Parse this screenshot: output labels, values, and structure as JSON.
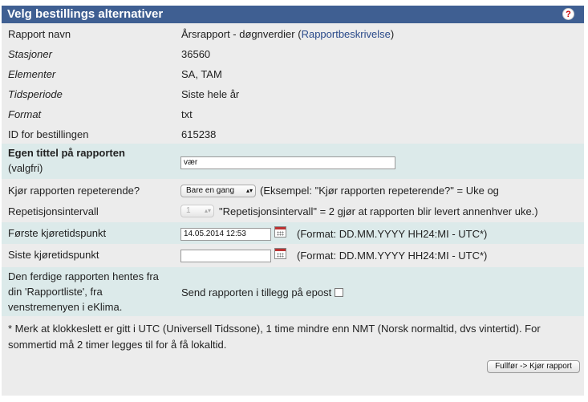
{
  "header": {
    "title": "Velg bestillings alternativer",
    "help_icon": "?"
  },
  "info": [
    {
      "label": "Rapport navn",
      "value": "Årsrapport - døgnverdier",
      "link": "Rapportbeskrivelse"
    },
    {
      "label": "Stasjoner",
      "value": "36560"
    },
    {
      "label": "Elementer",
      "value": "SA, TAM"
    },
    {
      "label": "Tidsperiode",
      "value": "Siste hele år"
    },
    {
      "label": "Format",
      "value": "txt"
    },
    {
      "label": "ID for bestillingen",
      "value": "615238"
    }
  ],
  "title_field": {
    "label": "Egen tittel på rapporten",
    "sub": "(valgfri)",
    "value": "vær"
  },
  "repeat": {
    "label": "Kjør rapporten repeterende?",
    "selected": "Bare en gang",
    "hint": "(Eksempel: \"Kjør rapporten repeterende?\" = Uke og"
  },
  "interval": {
    "label": "Repetisjonsintervall",
    "selected": "1",
    "hint": "\"Repetisjonsintervall\" = 2 gjør at rapporten blir levert annenhver uke.)"
  },
  "first_run": {
    "label": "Første kjøretidspunkt",
    "value": "14.05.2014 12:53",
    "format": "(Format: DD.MM.YYYY HH24:MI - UTC*)"
  },
  "last_run": {
    "label": "Siste kjøretidspunkt",
    "value": "",
    "format": "(Format: DD.MM.YYYY HH24:MI - UTC*)"
  },
  "delivery": {
    "line1": "Den ferdige rapporten hentes fra",
    "line2": "din 'Rapportliste', fra",
    "line3": "venstremenyen i eKlima.",
    "email_label": "Send rapporten i tillegg på epost"
  },
  "note": {
    "line1": "* Merk at klokkeslett er gitt i UTC (Universell Tidssone), 1 time mindre enn NMT (Norsk normaltid, dvs vintertid). For",
    "line2": "sommertid må 2 timer legges til for å få lokaltid."
  },
  "submit_label": "Fullfør -> Kjør rapport"
}
